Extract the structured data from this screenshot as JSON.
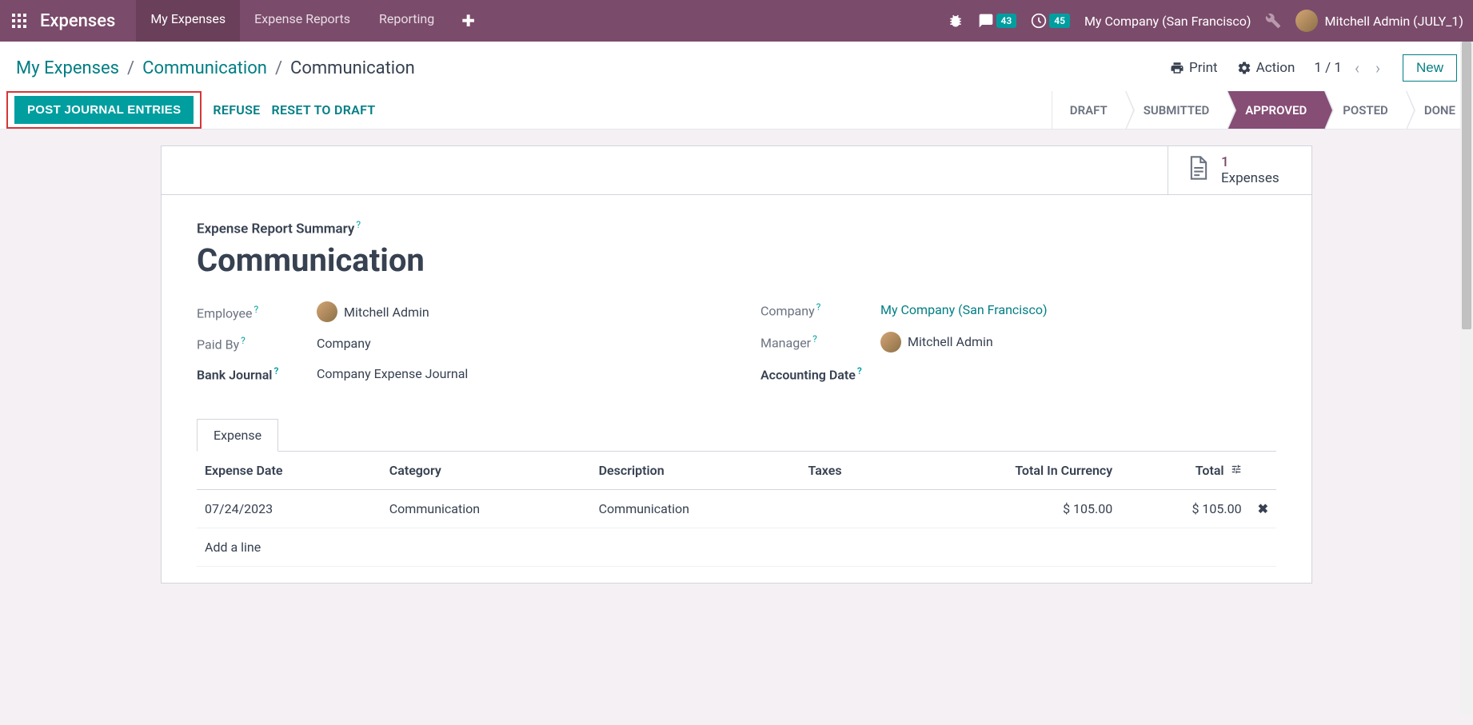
{
  "navbar": {
    "brand": "Expenses",
    "menu": [
      {
        "label": "My Expenses",
        "active": true
      },
      {
        "label": "Expense Reports",
        "active": false
      },
      {
        "label": "Reporting",
        "active": false
      }
    ],
    "chat_badge": "43",
    "clock_badge": "45",
    "company": "My Company (San Francisco)",
    "user": "Mitchell Admin (JULY_1)"
  },
  "breadcrumb": {
    "items": [
      "My Expenses",
      "Communication"
    ],
    "current": "Communication"
  },
  "control": {
    "print": "Print",
    "action": "Action",
    "pager": "1 / 1",
    "new": "New"
  },
  "actions": {
    "post": "POST JOURNAL ENTRIES",
    "refuse": "REFUSE",
    "reset": "RESET TO DRAFT"
  },
  "statuses": [
    {
      "label": "DRAFT",
      "active": false
    },
    {
      "label": "SUBMITTED",
      "active": false
    },
    {
      "label": "APPROVED",
      "active": true
    },
    {
      "label": "POSTED",
      "active": false
    },
    {
      "label": "DONE",
      "active": false
    }
  ],
  "stat": {
    "value": "1",
    "label": "Expenses"
  },
  "form": {
    "summary_label": "Expense Report Summary",
    "title": "Communication",
    "employee_label": "Employee",
    "employee_value": "Mitchell Admin",
    "paidby_label": "Paid By",
    "paidby_value": "Company",
    "journal_label": "Bank Journal",
    "journal_value": "Company Expense Journal",
    "company_label": "Company",
    "company_value": "My Company (San Francisco)",
    "manager_label": "Manager",
    "manager_value": "Mitchell Admin",
    "accdate_label": "Accounting Date"
  },
  "tabs": {
    "expense": "Expense"
  },
  "table": {
    "headers": {
      "date": "Expense Date",
      "category": "Category",
      "description": "Description",
      "taxes": "Taxes",
      "total_currency": "Total In Currency",
      "total": "Total"
    },
    "rows": [
      {
        "date": "07/24/2023",
        "category": "Communication",
        "description": "Communication",
        "taxes": "",
        "total_currency": "$ 105.00",
        "total": "$ 105.00"
      }
    ],
    "add_line": "Add a line"
  }
}
